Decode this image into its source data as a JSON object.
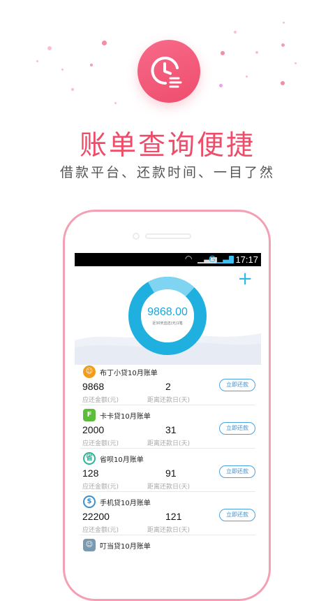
{
  "headline": "账单查询便捷",
  "subline": "借款平台、还款时间、一目了然",
  "accent_color": "#ee4d6a",
  "hero_icon": "clock-list-icon",
  "statusbar": {
    "time": "17:17",
    "network": "G"
  },
  "summary": {
    "total": "9868.00",
    "caption": "近30天应还(元)1笔",
    "add_icon": "plus-icon"
  },
  "bills": [
    {
      "title": "布丁小贷10月账单",
      "amount": "9868",
      "days": "2",
      "amount_label": "应还金额(元)",
      "days_label": "距离还款日(天)",
      "button": "立即还款",
      "icon": "budding-logo-icon",
      "color": "#f39c1a"
    },
    {
      "title": "卡卡贷10月账单",
      "amount": "2000",
      "days": "31",
      "amount_label": "应还金额(元)",
      "days_label": "距离还款日(天)",
      "button": "立即还款",
      "icon": "kakadai-logo-icon",
      "color": "#5bbd3a"
    },
    {
      "title": "省呗10月账单",
      "amount": "128",
      "days": "91",
      "amount_label": "应还金额(元)",
      "days_label": "距离还款日(天)",
      "button": "立即还款",
      "icon": "shengbei-logo-icon",
      "color": "#2db39a"
    },
    {
      "title": "手机贷10月账单",
      "amount": "22200",
      "days": "121",
      "amount_label": "应还金额(元)",
      "days_label": "距离还款日(天)",
      "button": "立即还款",
      "icon": "shoujidai-logo-icon",
      "color": "#3a8fd0"
    },
    {
      "title": "叮当贷10月账单",
      "icon": "dingdang-logo-icon",
      "color": "#7a9ab0"
    }
  ]
}
